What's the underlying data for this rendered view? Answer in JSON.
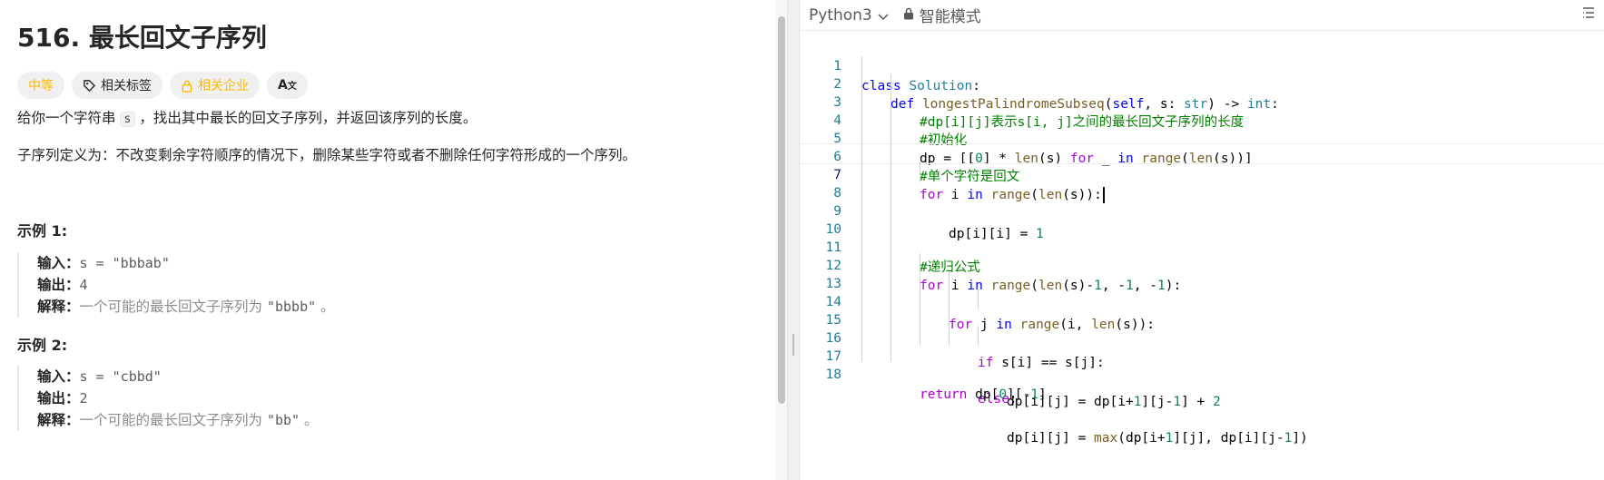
{
  "problem": {
    "title": "516. 最长回文子序列",
    "tags": {
      "difficulty": "中等",
      "related_tags": "相关标签",
      "related_companies": "相关企业",
      "translate_icon": "translate-icon"
    },
    "description_before": "给你一个字符串",
    "description_code": "s",
    "description_after": "，找出其中最长的回文子序列，并返回该序列的长度。",
    "definition": "子序列定义为：不改变剩余字符顺序的情况下，删除某些字符或者不删除任何字符形成的一个序列。",
    "examples": [
      {
        "title": "示例 1:",
        "input_label": "输入：",
        "input_value": "s = \"bbbab\"",
        "output_label": "输出：",
        "output_value": "4",
        "explain_label": "解释：",
        "explain_text": "一个可能的最长回文子序列为",
        "explain_value": "\"bbbb\"",
        "explain_tail": "。"
      },
      {
        "title": "示例 2:",
        "input_label": "输入：",
        "input_value": "s = \"cbbd\"",
        "output_label": "输出：",
        "output_value": "2",
        "explain_label": "解释：",
        "explain_text": "一个可能的最长回文子序列为",
        "explain_value": "\"bb\"",
        "explain_tail": "。"
      }
    ]
  },
  "editor": {
    "language": "Python3",
    "mode": "智能模式",
    "line_numbers": [
      "1",
      "2",
      "3",
      "4",
      "5",
      "6",
      "7",
      "8",
      "9",
      "10",
      "11",
      "12",
      "13",
      "14",
      "15",
      "16",
      "17",
      "18"
    ],
    "active_line": 7,
    "code": {
      "l1_kw": "class",
      "l1_cls": "Solution",
      "l1_rest": ":",
      "l2_kw": "def",
      "l2_fn": "longestPalindromeSubseq",
      "l2_a": "(",
      "l2_self": "self",
      "l2_b": ", s: ",
      "l2_str": "str",
      "l2_c": ") -> ",
      "l2_int": "int",
      "l2_d": ":",
      "l3": "#dp[i][j]表示s[i, j]之间的最长回文子序列的长度",
      "l4": "#初始化",
      "l5_a": "dp = [[",
      "l5_0": "0",
      "l5_b": "] * ",
      "l5_len": "len",
      "l5_c": "(s) ",
      "l5_for": "for",
      "l5_d": " _ ",
      "l5_in": "in",
      "l5_e": " ",
      "l5_range": "range",
      "l5_f": "(",
      "l5_len2": "len",
      "l5_g": "(s))]",
      "l6": "#单个字符是回文",
      "l7_for": "for",
      "l7_a": " i ",
      "l7_in": "in",
      "l7_b": " ",
      "l7_range": "range",
      "l7_c": "(",
      "l7_len": "len",
      "l7_d": "(s)):",
      "l8_a": "dp[i][i] = ",
      "l8_1": "1",
      "l11": "#递归公式",
      "l12_for": "for",
      "l12_a": " i ",
      "l12_in": "in",
      "l12_b": " ",
      "l12_range": "range",
      "l12_c": "(",
      "l12_len": "len",
      "l12_d": "(s)-",
      "l12_1": "1",
      "l12_e": ", -",
      "l12_2": "1",
      "l12_f": ", -",
      "l12_3": "1",
      "l12_g": "):",
      "l13_for": "for",
      "l13_a": " j ",
      "l13_in": "in",
      "l13_b": " ",
      "l13_range": "range",
      "l13_c": "(i, ",
      "l13_len": "len",
      "l13_d": "(s)):",
      "l14_if": "if",
      "l14_a": " s[i] == s[j]:",
      "l15_a": "dp[i][j] = dp[i+",
      "l15_1": "1",
      "l15_b": "][j-",
      "l15_2": "1",
      "l15_c": "] + ",
      "l15_3": "2",
      "l16_else": "else",
      "l16_a": ":",
      "l17_a": "dp[i][j] = ",
      "l17_max": "max",
      "l17_b": "(dp[i+",
      "l17_1": "1",
      "l17_c": "][j], dp[i][j-",
      "l17_2": "1",
      "l17_d": "])",
      "l18_return": "return",
      "l18_a": " dp[",
      "l18_0": "0",
      "l18_b": "][-",
      "l18_1": "1",
      "l18_c": "]"
    }
  },
  "colors": {
    "difficulty": "#ffb800",
    "keyword": "#0000ff",
    "control_keyword": "#af00db",
    "class_name": "#267f99",
    "function_name": "#795e26",
    "number": "#098658",
    "comment": "#008000",
    "line_number": "#237893"
  }
}
